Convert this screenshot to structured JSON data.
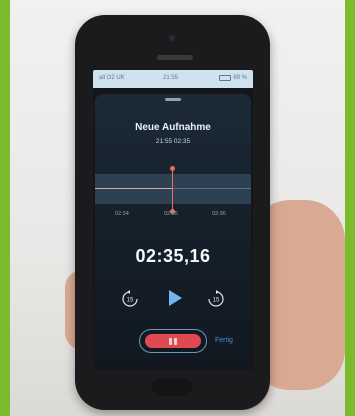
{
  "status_bar": {
    "carrier": "all O2 UK",
    "time": "21:55",
    "battery": "69 %"
  },
  "recording": {
    "title": "Neue Aufnahme",
    "meta": "21:55  02:35",
    "elapsed": "02:35,16"
  },
  "timeline": {
    "labels": [
      "02:34",
      "02:35",
      "02:36"
    ],
    "progress": 0.5
  },
  "controls": {
    "done_label": "Fertig",
    "skip_back_value": "15",
    "skip_forward_value": "15"
  },
  "colors": {
    "background": "#7cbc2c",
    "accent_red": "#df4a52",
    "accent_blue": "#4a8fd6"
  }
}
